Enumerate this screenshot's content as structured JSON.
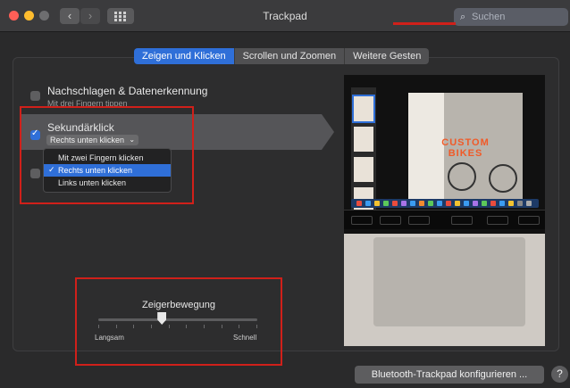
{
  "window": {
    "title": "Trackpad"
  },
  "search": {
    "placeholder": "Suchen",
    "icon": "search-icon"
  },
  "tabs": [
    {
      "label": "Zeigen und Klicken",
      "active": true
    },
    {
      "label": "Scrollen und Zoomen",
      "active": false
    },
    {
      "label": "Weitere Gesten",
      "active": false
    }
  ],
  "options": {
    "lookup": {
      "label": "Nachschlagen & Datenerkennung",
      "sub": "Mit drei Fingern tippen",
      "checked": false
    },
    "secondary_click": {
      "label": "Sekundärklick",
      "selected": "Rechts unten klicken",
      "checked": true
    }
  },
  "secondary_click_menu": {
    "items": [
      "Mit zwei Fingern klicken",
      "Rechts unten klicken",
      "Links unten klicken"
    ],
    "selected_index": 1
  },
  "pointer_speed": {
    "label": "Zeigerbewegung",
    "min_label": "Langsam",
    "max_label": "Schnell",
    "value_fraction": 0.4
  },
  "preview": {
    "headline": "CUSTOM BIKES"
  },
  "footer": {
    "bluetooth_button": "Bluetooth-Trackpad konfigurieren ...",
    "help": "?"
  },
  "colors": {
    "accent": "#2f6fd8",
    "annotation_red": "#d0201a"
  }
}
